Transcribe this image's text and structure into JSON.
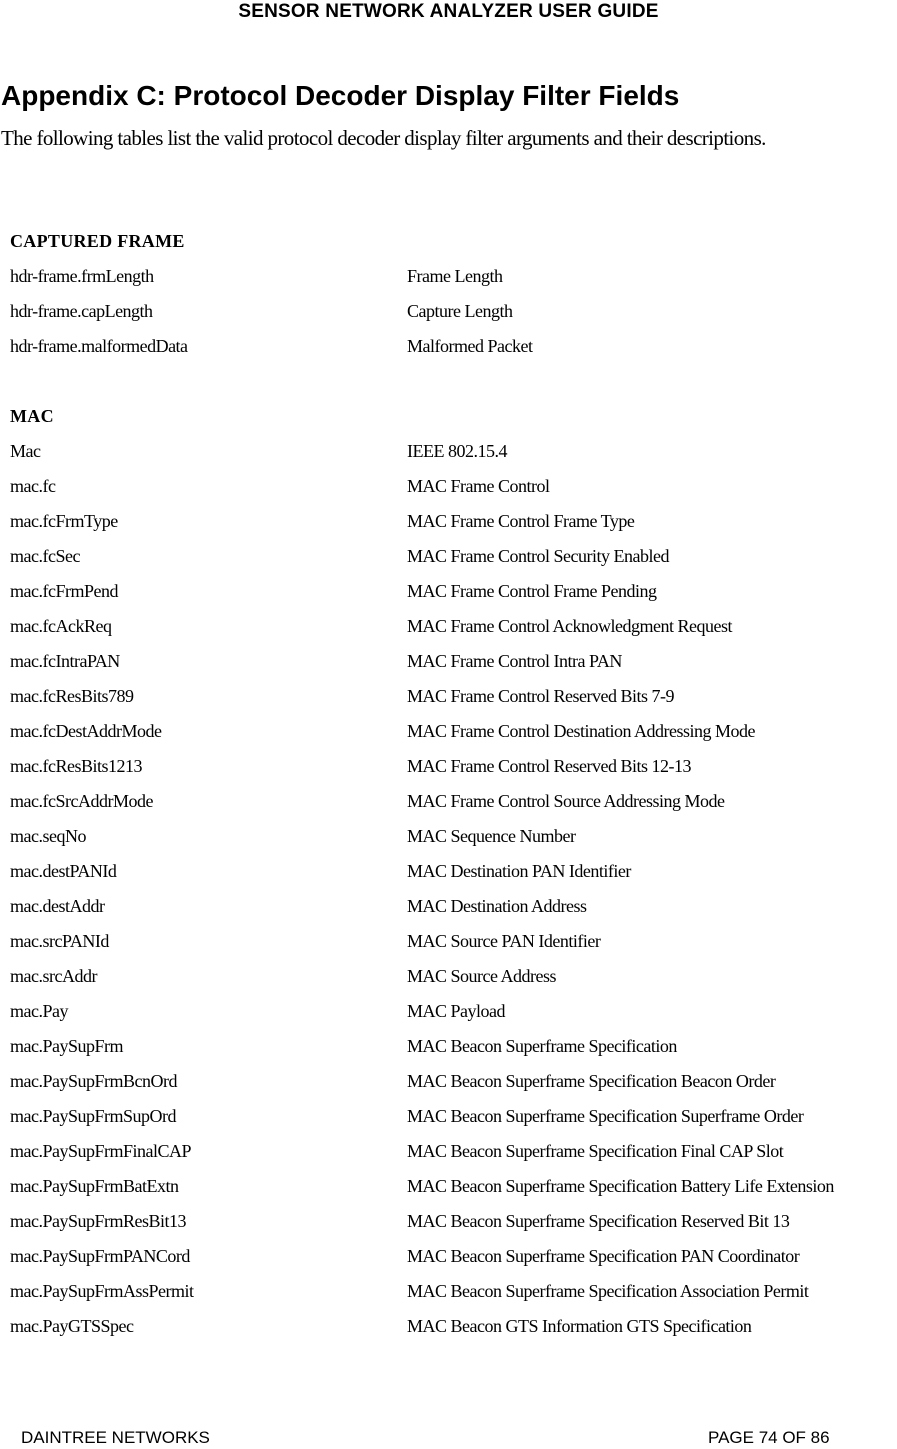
{
  "header": {
    "running_title": "SENSOR NETWORK ANALYZER USER GUIDE"
  },
  "title": "Appendix C: Protocol Decoder Display Filter Fields",
  "intro": "The following tables list the valid protocol decoder display filter arguments and their descriptions.",
  "sections": [
    {
      "heading": "CAPTURED FRAME",
      "rows": [
        {
          "field": "hdr-frame.frmLength",
          "description": "Frame Length"
        },
        {
          "field": "hdr-frame.capLength",
          "description": "Capture Length"
        },
        {
          "field": "hdr-frame.malformedData",
          "description": "Malformed Packet"
        }
      ]
    },
    {
      "heading": "MAC",
      "rows": [
        {
          "field": "Mac",
          "description": "IEEE 802.15.4"
        },
        {
          "field": "mac.fc",
          "description": "MAC Frame Control"
        },
        {
          "field": "mac.fcFrmType",
          "description": "MAC Frame Control Frame Type"
        },
        {
          "field": "mac.fcSec",
          "description": "MAC Frame Control Security Enabled"
        },
        {
          "field": "mac.fcFrmPend",
          "description": "MAC Frame Control Frame Pending"
        },
        {
          "field": "mac.fcAckReq",
          "description": "MAC Frame Control Acknowledgment Request"
        },
        {
          "field": "mac.fcIntraPAN",
          "description": "MAC Frame Control Intra PAN"
        },
        {
          "field": "mac.fcResBits789",
          "description": "MAC Frame Control Reserved Bits 7-9"
        },
        {
          "field": "mac.fcDestAddrMode",
          "description": "MAC Frame Control Destination Addressing Mode"
        },
        {
          "field": "mac.fcResBits1213",
          "description": "MAC Frame Control Reserved Bits 12-13"
        },
        {
          "field": "mac.fcSrcAddrMode",
          "description": "MAC Frame Control Source Addressing Mode"
        },
        {
          "field": "mac.seqNo",
          "description": "MAC Sequence Number"
        },
        {
          "field": "mac.destPANId",
          "description": "MAC Destination PAN Identifier"
        },
        {
          "field": "mac.destAddr",
          "description": "MAC Destination Address"
        },
        {
          "field": "mac.srcPANId",
          "description": "MAC Source PAN Identifier"
        },
        {
          "field": "mac.srcAddr",
          "description": "MAC Source Address"
        },
        {
          "field": "mac.Pay",
          "description": "MAC Payload"
        },
        {
          "field": "mac.PaySupFrm",
          "description": "MAC Beacon Superframe Specification"
        },
        {
          "field": "mac.PaySupFrmBcnOrd",
          "description": "MAC Beacon Superframe Specification Beacon Order"
        },
        {
          "field": "mac.PaySupFrmSupOrd",
          "description": "MAC Beacon Superframe Specification Superframe Order"
        },
        {
          "field": "mac.PaySupFrmFinalCAP",
          "description": "MAC Beacon Superframe Specification Final CAP Slot"
        },
        {
          "field": "mac.PaySupFrmBatExtn",
          "description": "MAC Beacon Superframe Specification Battery Life Extension"
        },
        {
          "field": "mac.PaySupFrmResBit13",
          "description": "MAC Beacon Superframe Specification Reserved Bit 13"
        },
        {
          "field": "mac.PaySupFrmPANCord",
          "description": "MAC Beacon Superframe Specification PAN Coordinator"
        },
        {
          "field": "mac.PaySupFrmAssPermit",
          "description": "MAC Beacon Superframe Specification Association Permit"
        },
        {
          "field": "mac.PayGTSSpec",
          "description": "MAC Beacon GTS Information GTS Specification"
        }
      ]
    }
  ],
  "footer": {
    "company": "DAINTREE NETWORKS",
    "page": "PAGE 74 OF 86"
  }
}
